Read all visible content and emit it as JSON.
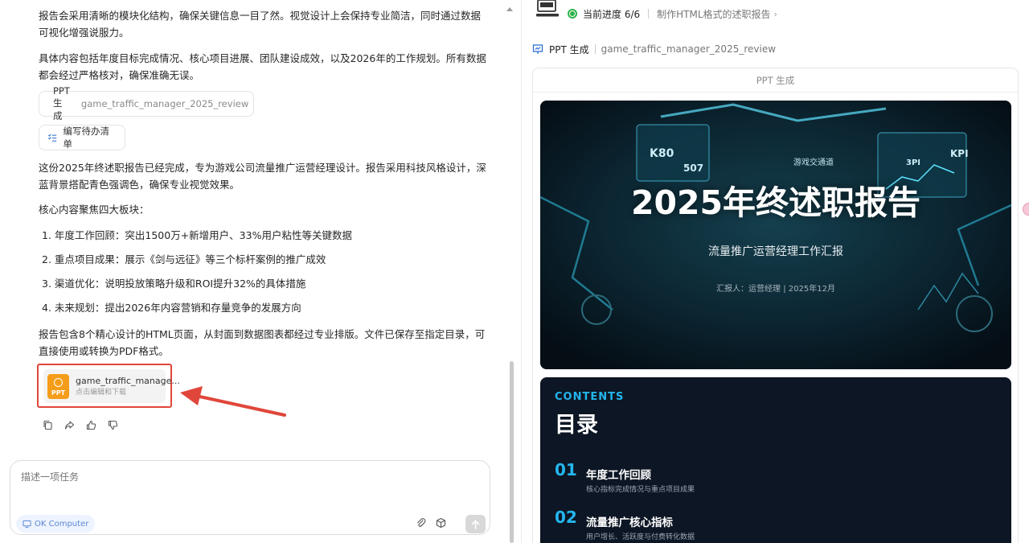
{
  "chat": {
    "p1": "报告会采用清晰的模块化结构，确保关键信息一目了然。视觉设计上会保持专业简洁，同时通过数据可视化增强说服力。",
    "p2": "具体内容包括年度目标完成情况、核心项目进展、团队建设成效，以及2026年的工作规划。所有数据都会经过严格核对，确保准确无误。",
    "chip_ppt_label": "PPT 生成",
    "chip_ppt_file": "game_traffic_manager_2025_review",
    "chip_todo_label": "编写待办清单",
    "p3": "这份2025年终述职报告已经完成，专为游戏公司流量推广运营经理设计。报告采用科技风格设计，深蓝背景搭配青色强调色，确保专业视觉效果。",
    "p4": "核心内容聚焦四大板块：",
    "list": [
      "1. 年度工作回顾：突出1500万+新增用户、33%用户粘性等关键数据",
      "2. 重点项目成果：展示《剑与远征》等三个标杆案例的推广成效",
      "3. 渠道优化：说明投放策略升级和ROI提升32%的具体措施",
      "4. 未来规划：提出2026年内容营销和存量竞争的发展方向"
    ],
    "p5": "报告包含8个精心设计的HTML页面，从封面到数据图表都经过专业排版。文件已保存至指定目录，可直接使用或转换为PDF格式。",
    "file_card": {
      "icon_label": "PPT",
      "name": "game_traffic_manage...",
      "hint": "点击编辑和下载"
    },
    "actions": [
      "copy-icon",
      "share-icon",
      "thumbs-up-icon",
      "thumbs-down-icon"
    ]
  },
  "input": {
    "placeholder": "描述一项任务",
    "mode_badge": "OK Computer"
  },
  "panel": {
    "progress_label": "当前进度 6/6",
    "progress_task": "制作HTML格式的述职报告",
    "tool_label": "PPT 生成",
    "tool_file": "game_traffic_manager_2025_review",
    "viewer_title": "PPT 生成"
  },
  "slide1": {
    "title": "2025年终述职报告",
    "subtitle": "流量推广运营经理工作汇报",
    "reporter": "汇报人：运营经理 | 2025年12月",
    "bg_badges": [
      "K80",
      "507",
      "KPI",
      "3PI",
      "游戏交通道"
    ]
  },
  "slide2": {
    "contents_en": "CONTENTS",
    "contents_zh": "目录",
    "items": [
      {
        "num": "01",
        "title": "年度工作回顾",
        "desc": "核心指标完成情况与重点项目成果"
      },
      {
        "num": "02",
        "title": "流量推广核心指标",
        "desc": "用户增长、活跃度与付费转化数据"
      }
    ]
  },
  "colors": {
    "accent_cyan": "#24b6ee",
    "highlight_red": "#e0463a",
    "ppt_orange": "#f59d1a",
    "progress_green": "#2fb34a"
  }
}
